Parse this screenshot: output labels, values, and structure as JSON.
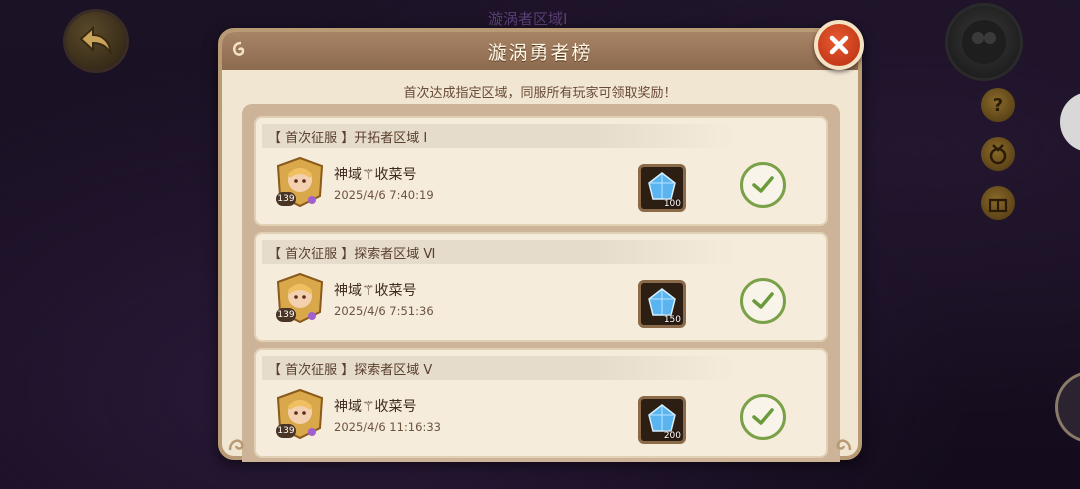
{
  "background": {
    "title": "漩涡者区域Ⅰ"
  },
  "dialog": {
    "title": "漩涡勇者榜",
    "subtitle": "首次达成指定区域，同服所有玩家可领取奖励！",
    "entries": [
      {
        "header": "【 首次征服 】开拓者区域 Ⅰ",
        "player": "神域⚚收菜号",
        "level": "139",
        "time": "2025/4/6 7:40:19",
        "reward_qty": "100",
        "claimed": true
      },
      {
        "header": "【 首次征服 】探索者区域 Ⅵ",
        "player": "神域⚚收菜号",
        "level": "139",
        "time": "2025/4/6 7:51:36",
        "reward_qty": "150",
        "claimed": true
      },
      {
        "header": "【 首次征服 】探索者区域 Ⅴ",
        "player": "神域⚚收菜号",
        "level": "139",
        "time": "2025/4/6 11:16:33",
        "reward_qty": "200",
        "claimed": true
      }
    ]
  },
  "side_icons": [
    "help-icon",
    "medal-icon",
    "gift-icon"
  ],
  "colors": {
    "accent": "#e85a30",
    "check": "#7aa048",
    "header": "#8c6a4e"
  }
}
